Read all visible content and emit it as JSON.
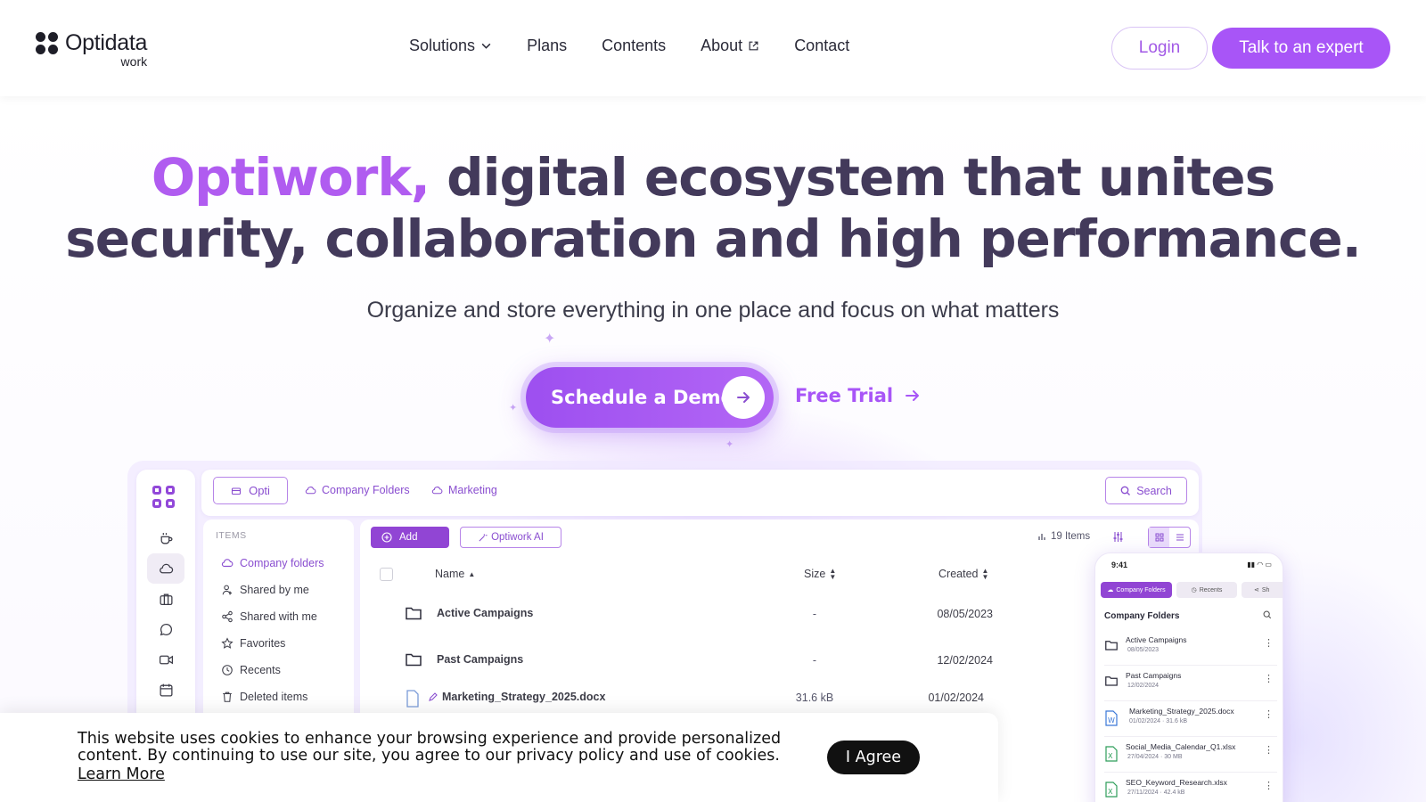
{
  "header": {
    "logo_name": "Optidata",
    "logo_sub": "work",
    "nav": [
      {
        "label": "Solutions",
        "icon": "chevron-down-icon"
      },
      {
        "label": "Plans"
      },
      {
        "label": "Contents"
      },
      {
        "label": "About",
        "icon": "external-link-icon"
      },
      {
        "label": "Contact"
      }
    ],
    "login_label": "Login",
    "expert_label": "Talk to an expert"
  },
  "hero": {
    "headline_accent": "Optiwork,",
    "headline_rest_1": " digital ecosystem that unites",
    "headline_line_2": "security, collaboration and high performance.",
    "subhead": "Organize and store everything in one place and focus on what matters",
    "demo_label": "Schedule a Demo",
    "free_trial_label": "Free Trial"
  },
  "app": {
    "topbar": {
      "workspace_chip": "Opti",
      "crumbs": [
        "Company Folders",
        "Marketing"
      ],
      "search_label": "Search"
    },
    "sidebar": {
      "title": "ITEMS",
      "items": [
        {
          "label": "Company folders",
          "icon": "cloud-icon",
          "active": true
        },
        {
          "label": "Shared by me",
          "icon": "user-share-icon"
        },
        {
          "label": "Shared with me",
          "icon": "share-icon"
        },
        {
          "label": "Favorites",
          "icon": "star-icon"
        },
        {
          "label": "Recents",
          "icon": "clock-icon"
        },
        {
          "label": "Deleted items",
          "icon": "trash-icon"
        }
      ]
    },
    "toolbar": {
      "add_label": "Add",
      "ai_label": "Optiwork AI",
      "items_count": "19 Items"
    },
    "table": {
      "columns": [
        "Name",
        "Size",
        "Created"
      ],
      "rows": [
        {
          "name": "Active Campaigns",
          "size": "-",
          "created": "08/05/2023",
          "type": "folder"
        },
        {
          "name": "Past Campaigns",
          "size": "-",
          "created": "12/02/2024",
          "type": "folder"
        },
        {
          "name": "Marketing_Strategy_2025.docx",
          "size": "31.6 kB",
          "created": "01/02/2024",
          "type": "doc"
        }
      ]
    },
    "phone": {
      "time": "9:41",
      "tabs": [
        "Company Folders",
        "Recents",
        "Sh"
      ],
      "title": "Company Folders",
      "rows": [
        {
          "name": "Active Campaigns",
          "meta": "08/05/2023",
          "type": "folder"
        },
        {
          "name": "Past Campaigns",
          "meta": "12/02/2024",
          "type": "folder"
        },
        {
          "name": "Marketing_Strategy_2025.docx",
          "meta": "01/02/2024 · 31.6 kB",
          "type": "word"
        },
        {
          "name": "Social_Media_Calendar_Q1.xlsx",
          "meta": "27/04/2024 · 30 MB",
          "type": "excel"
        },
        {
          "name": "SEO_Keyword_Research.xlsx",
          "meta": "27/11/2024 · 42.4 kB",
          "type": "excel"
        }
      ]
    }
  },
  "cookie": {
    "text": "This website uses cookies to enhance your browsing experience and provide personalized content. By continuing to use our site, you agree to our privacy policy and use of cookies.",
    "link": "Learn More",
    "button": "I Agree"
  },
  "colors": {
    "accent": "#a855f7",
    "headline": "#433a5b",
    "ui_purple": "#8a4ed0"
  }
}
